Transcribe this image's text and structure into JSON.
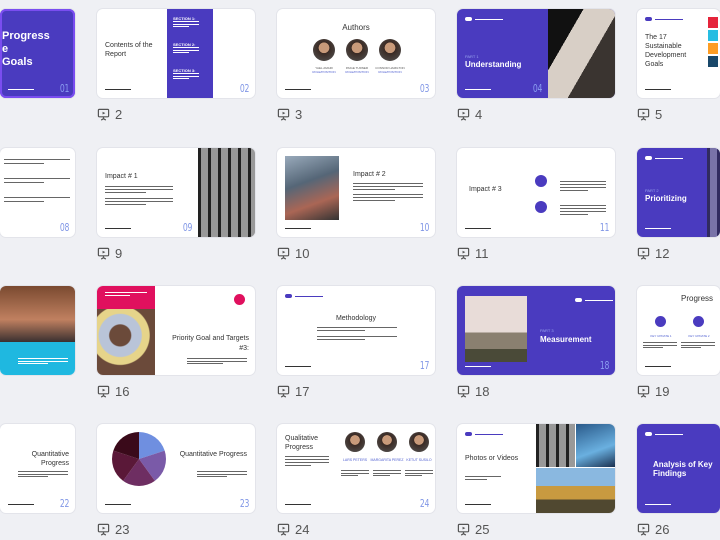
{
  "colors": {
    "accent": "#4a3bbf",
    "number": "#8197e6",
    "pink": "#e0105e",
    "cyan": "#1fb8e0",
    "selected": "#7a4df0"
  },
  "slides": [
    {
      "n": "1",
      "num": "01",
      "kind": "cover",
      "title_lines": [
        "Progress",
        "e",
        "Goals"
      ],
      "selected": true,
      "show_label": false
    },
    {
      "n": "2",
      "num": "02",
      "kind": "contents",
      "title": "Contents of the Report",
      "sections": [
        "SECTION 1:",
        "SECTION 2:",
        "SECTION 3:"
      ]
    },
    {
      "n": "3",
      "num": "03",
      "kind": "authors",
      "title": "Authors",
      "people": [
        {
          "name": "YAEL AMARI",
          "role": "ROLE/POSITION"
        },
        {
          "name": "PAIGE TURNER",
          "role": "ROLE/POSITION"
        },
        {
          "name": "CONNOR HAMILTON",
          "role": "ROLE/POSITION"
        }
      ]
    },
    {
      "n": "4",
      "num": "04",
      "kind": "part",
      "part": "PART 1",
      "title": "Understanding"
    },
    {
      "n": "5",
      "num": "",
      "kind": "sdg",
      "title": "The 17 Sustainable Development Goals"
    },
    {
      "n": "8",
      "num": "08",
      "kind": "textlist",
      "show_label": false
    },
    {
      "n": "9",
      "num": "09",
      "kind": "impact-right",
      "title": "Impact # 1"
    },
    {
      "n": "10",
      "num": "10",
      "kind": "impact-left",
      "title": "Impact # 2"
    },
    {
      "n": "11",
      "num": "11",
      "kind": "impact-icons",
      "title": "Impact # 3"
    },
    {
      "n": "12",
      "num": "",
      "kind": "part-img",
      "part": "PART 2",
      "title": "Prioritizing"
    },
    {
      "n": "15",
      "num": "",
      "kind": "photo-cyan",
      "show_label": false
    },
    {
      "n": "16",
      "num": "",
      "kind": "priority",
      "title": "Priority Goal and Targets #3:"
    },
    {
      "n": "17",
      "num": "17",
      "kind": "method",
      "title": "Methodology"
    },
    {
      "n": "18",
      "num": "18",
      "kind": "measure",
      "part": "PART 3",
      "title": "Measurement"
    },
    {
      "n": "19",
      "num": "",
      "kind": "progress",
      "title": "Progress",
      "updates": [
        "KEY UPDATE 1",
        "KEY UPDATE 2"
      ]
    },
    {
      "n": "22",
      "num": "22",
      "kind": "quant",
      "title": "Quantitative Progress",
      "show_label": false
    },
    {
      "n": "23",
      "num": "23",
      "kind": "quant-pie",
      "title": "Quantitative Progress",
      "pie": [
        20,
        20,
        20,
        20,
        20
      ]
    },
    {
      "n": "24",
      "num": "24",
      "kind": "qual",
      "title": "Qualitative Progress",
      "people": [
        {
          "name": "LARS PETERS"
        },
        {
          "name": "MARGARITA PEREZ"
        },
        {
          "name": "KETUT SUSILO"
        }
      ]
    },
    {
      "n": "25",
      "num": "",
      "kind": "photos",
      "title": "Photos or Videos"
    },
    {
      "n": "26",
      "num": "",
      "kind": "analysis",
      "title": "Analysis of Key Findings"
    }
  ]
}
